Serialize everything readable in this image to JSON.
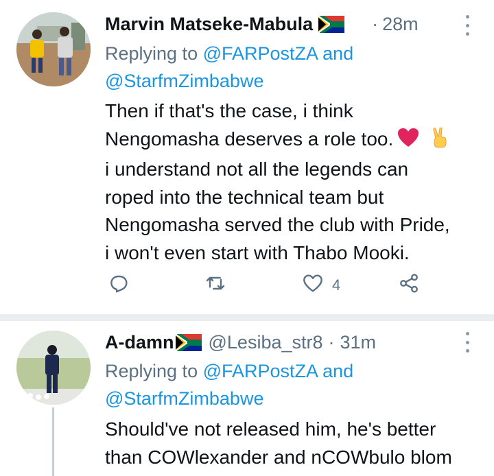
{
  "tweets": [
    {
      "display_name": "Marvin Matseke-Mabula",
      "handle": "",
      "separator": "·",
      "time": "28m",
      "flag_icon": "south-africa-flag-icon",
      "replying_prefix": "Replying to",
      "replying_to_1": "@FARPostZA",
      "replying_and": "and",
      "replying_to_2": "@StarfmZimbabwe",
      "body_lines": [
        "Then if that's the case, i think",
        "Nengomasha deserves a role too.",
        "i understand not all the legends can",
        "roped into the technical team but",
        "Nengomasha served the club with Pride,",
        "i won't even start with Thabo Mooki."
      ],
      "emojis": [
        "red-heart-icon",
        "victory-hand-icon"
      ],
      "actions": {
        "reply": {
          "icon": "reply-icon",
          "count": ""
        },
        "retweet": {
          "icon": "retweet-icon",
          "count": ""
        },
        "like": {
          "icon": "heart-icon",
          "count": "4"
        },
        "share": {
          "icon": "share-icon",
          "count": ""
        }
      }
    },
    {
      "display_name": "A-damn",
      "handle": "@Lesiba_str8",
      "separator": "·",
      "time": "31m",
      "flag_icon": "south-africa-flag-icon",
      "replying_prefix": "Replying to",
      "replying_to_1": "@FARPostZA",
      "replying_and": "and",
      "replying_to_2": "@StarfmZimbabwe",
      "body_lines": [
        "Should've not released him, he's better",
        "than COWlexander and nCOWbulo blom"
      ]
    }
  ],
  "colors": {
    "text": "#0f1419",
    "secondary": "#5b7083",
    "link": "#1b95e0",
    "divider": "#ebeef0",
    "heart": "#e0245e"
  }
}
